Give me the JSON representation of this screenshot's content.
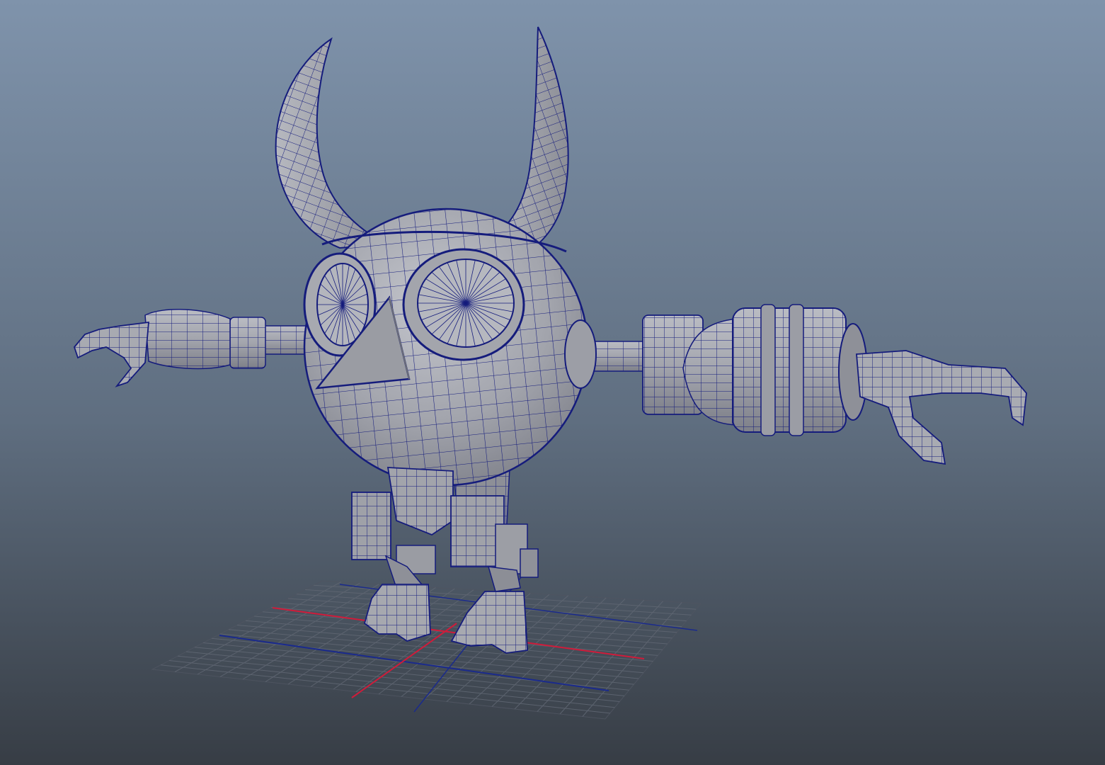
{
  "viewport": {
    "background_top": "#7f93ab",
    "background_bottom": "#373d45",
    "grid_color": "#5f6672",
    "axis_x_color": "#d01b3a",
    "axis_z_color": "#1a2a8c",
    "wire_color": "#121a7a",
    "mesh_fill": "#a4a6ae",
    "mesh_shade": "#8a8c94",
    "mesh_light": "#bdbfc6"
  },
  "model": {
    "parts": [
      "horn-left",
      "horn-right",
      "head-sphere",
      "eye-left",
      "eye-right",
      "beak",
      "arm-left",
      "arm-right",
      "claw-left",
      "claw-right",
      "leg-left",
      "leg-right",
      "foot-left",
      "foot-right"
    ]
  }
}
